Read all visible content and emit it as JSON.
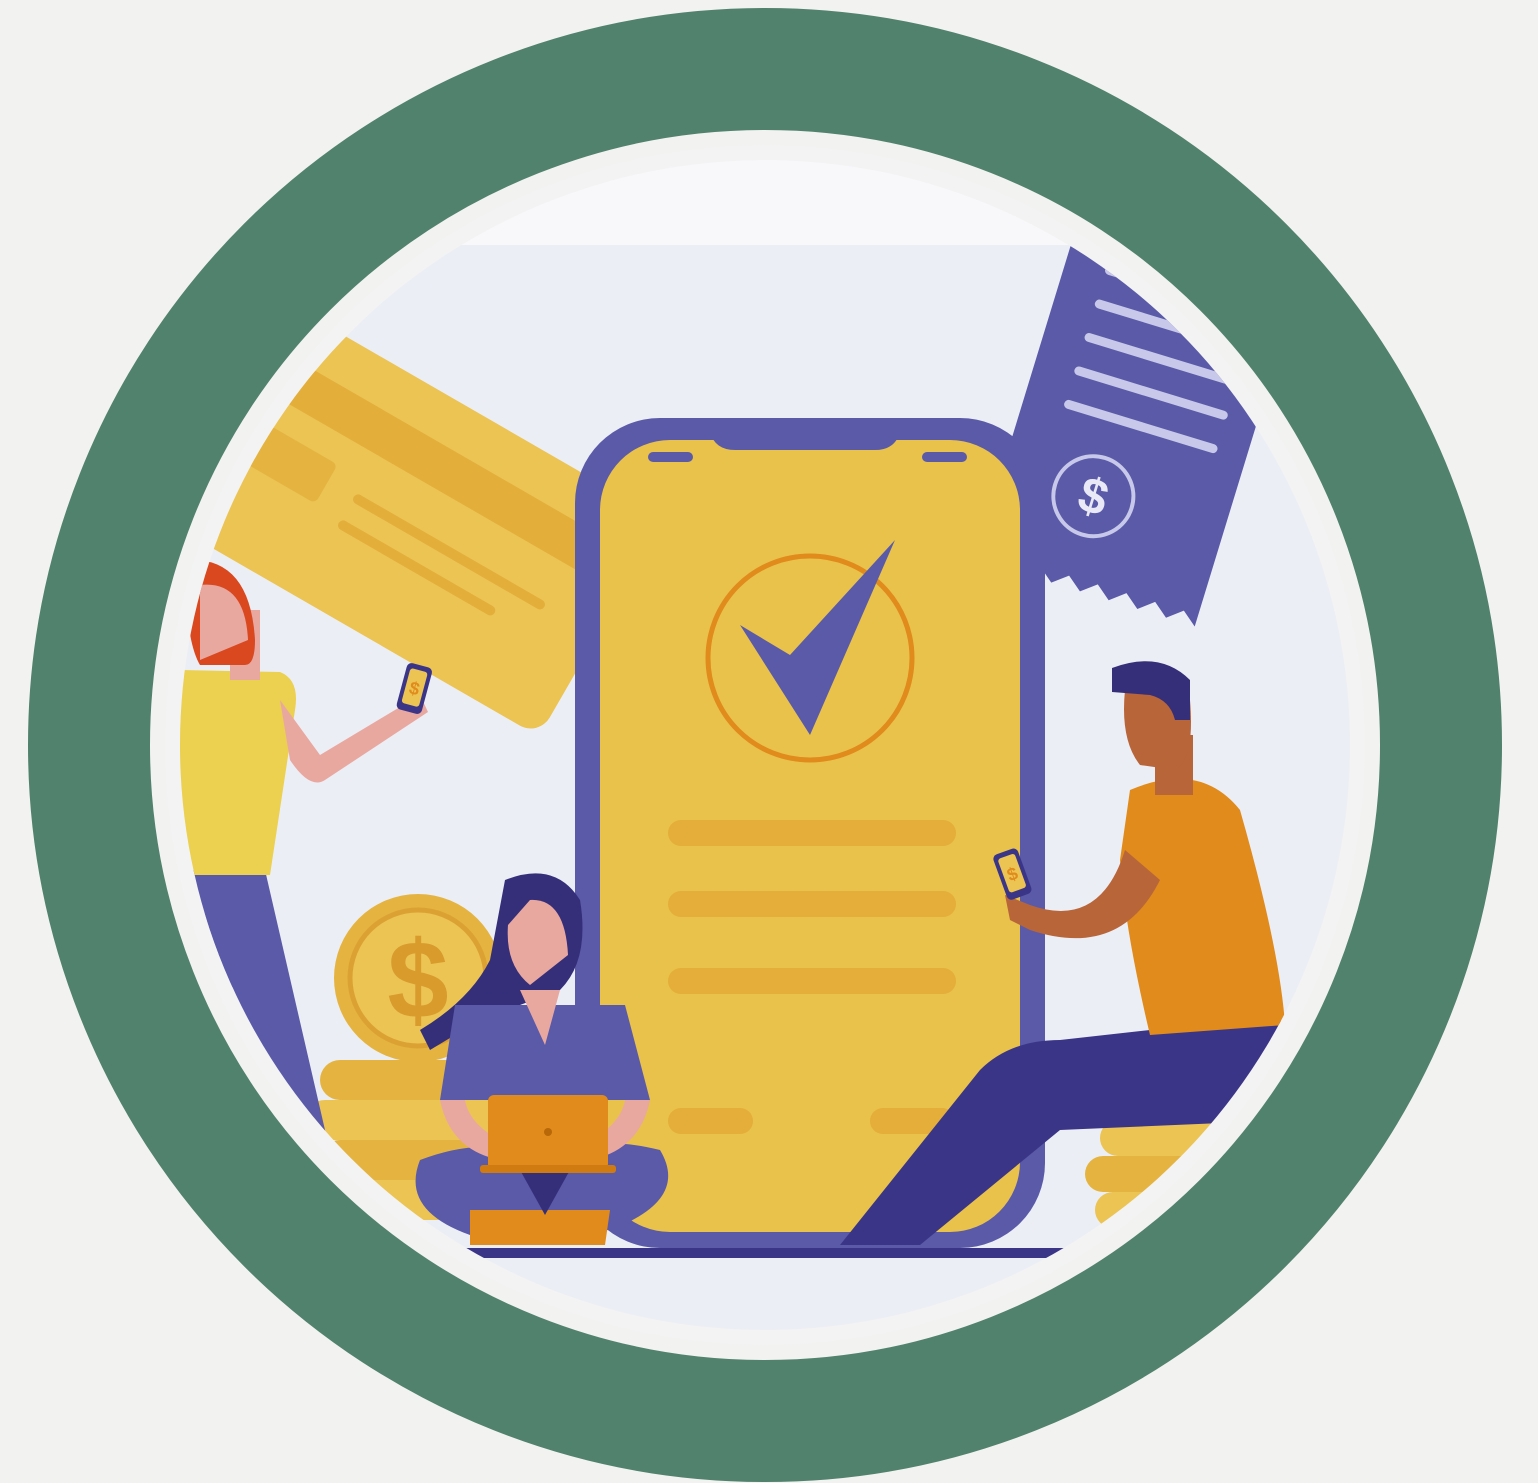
{
  "illustration": {
    "subject": "mobile-payment-success",
    "colors": {
      "background": "#f2f2f1",
      "ring": "#51826e",
      "inner_bg": "#ecedf4",
      "purple": "#5a5aa8",
      "dark_purple": "#3b3587",
      "yellow": "#e9c24b",
      "dark_yellow": "#e2ac33",
      "orange": "#e08b1c",
      "skin_light": "#e8a8a0",
      "skin_dark": "#b8653a",
      "hair_red": "#d9481f",
      "hair_dark": "#352f7a"
    },
    "icons": [
      "dollar-coin-icon",
      "checkmark-icon",
      "receipt-icon",
      "credit-card-icon",
      "phone-icon",
      "laptop-icon"
    ]
  }
}
